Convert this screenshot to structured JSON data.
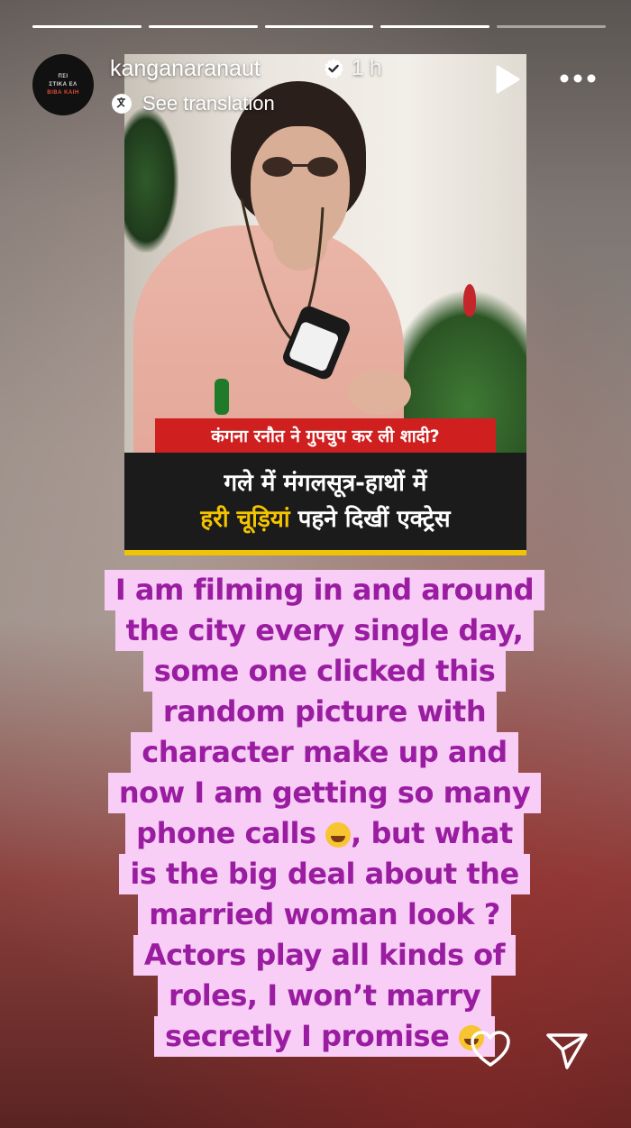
{
  "story": {
    "progress": [
      1.0,
      1.0,
      1.0,
      1.0,
      0.0
    ]
  },
  "header": {
    "avatar_lines": [
      "ΠΣΙ",
      "ΣΤΙΚΑ ΕΛ",
      "ΒΙΒΑ ΚΑΙΗ"
    ],
    "username": "kanganaranaut",
    "time": "1 h",
    "see_translation": "See translation"
  },
  "photo": {
    "red_banner": "कंगना रनौत ने गुपचुप कर ली शादी?",
    "line1": "गले में मंगलसूत्र-हाथों में",
    "line2_highlight": "हरी चूड़ियां",
    "line2_rest": " पहने दिखीं एक्ट्रेस"
  },
  "caption": {
    "lines": [
      "I am filming in and around",
      "the city every single day,",
      "some one clicked this",
      "random picture with",
      "character make up and",
      "now I am getting so many",
      "phone calls",
      ", but what",
      "is the big deal about the",
      "married woman look ?",
      "Actors play all kinds of",
      "roles, I won’t marry",
      "secretly I promise"
    ]
  },
  "colors": {
    "caption_bg": "#f8cdf6",
    "caption_text": "#9a1da1",
    "banner_red": "#d01f1f",
    "banner_yellow": "#f5c400"
  },
  "icons": {
    "verified": "verified-badge-icon",
    "translate": "translate-icon",
    "play": "play-icon",
    "more": "more-dots-icon",
    "like": "heart-icon",
    "share": "send-icon"
  }
}
